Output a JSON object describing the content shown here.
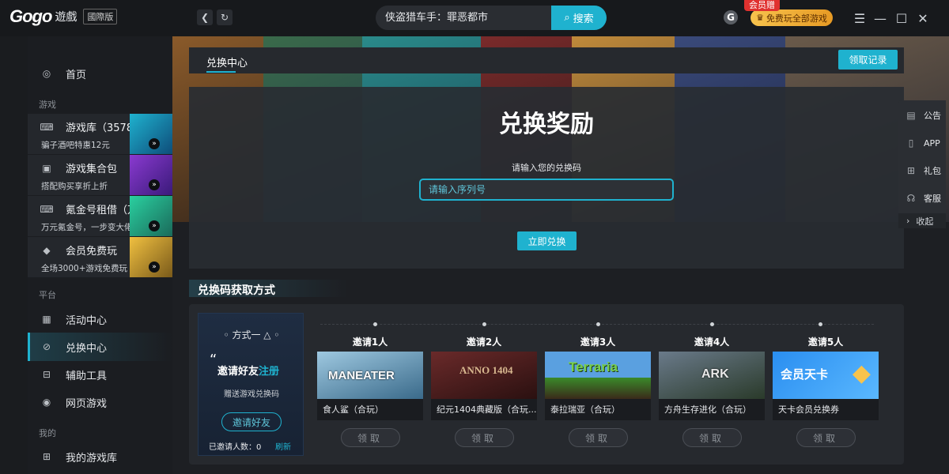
{
  "app": {
    "logo_text": "Gogo",
    "logo_sub": "遊戲",
    "region_badge": "國際版"
  },
  "topbar": {
    "search_value": "侠盗猎车手：罪恶都市",
    "search_label": "搜索",
    "account_letter": "G",
    "vip_tag": "会员赠",
    "vip_label": "免费玩全部游戏"
  },
  "sidebar": {
    "home": "首页",
    "group_games": "游戏",
    "game_items": [
      {
        "title": "游戏库（3578款）",
        "sub": "骗子酒吧特惠12元"
      },
      {
        "title": "游戏集合包",
        "sub": "搭配购买享折上折"
      },
      {
        "title": "氪金号租借（万元号）",
        "sub": "万元氪金号，一步变大佬"
      },
      {
        "title": "会员免费玩",
        "sub": "全场3000+游戏免费玩"
      }
    ],
    "group_platform": "平台",
    "platform_items": [
      {
        "label": "活动中心"
      },
      {
        "label": "兑换中心"
      },
      {
        "label": "辅助工具"
      },
      {
        "label": "网页游戏"
      }
    ],
    "group_mine": "我的",
    "mine_items": [
      {
        "label": "我的游戏库"
      }
    ]
  },
  "main": {
    "tab_label": "兑换中心",
    "record_button": "领取记录",
    "redeem_title": "兑换奖励",
    "redeem_label": "请输入您的兑换码",
    "redeem_placeholder": "请输入序列号",
    "redeem_button": "立即兑换"
  },
  "float_menu": {
    "items": [
      "公告",
      "APP",
      "礼包",
      "客服"
    ],
    "collapse": "收起"
  },
  "methods": {
    "section_title": "兑换码获取方式",
    "card_head": "方式一",
    "card_main_prefix": "邀请好友",
    "card_main_highlight": "注册",
    "card_sub": "赠送游戏兑换码",
    "card_invite_button": "邀请好友",
    "card_count_label": "已邀请人数：0",
    "card_refresh": "刷新",
    "rewards": [
      {
        "tier": "邀请1人",
        "name": "食人鲨（合玩）",
        "art": "MANEATER",
        "claim": "领取"
      },
      {
        "tier": "邀请2人",
        "name": "纪元1404典藏版（合玩...",
        "art": "ANNO 1404",
        "claim": "领取"
      },
      {
        "tier": "邀请3人",
        "name": "泰拉瑞亚（合玩）",
        "art": "Terraria",
        "claim": "领取"
      },
      {
        "tier": "邀请4人",
        "name": "方舟生存进化（合玩）",
        "art": "ARK",
        "claim": "领取"
      },
      {
        "tier": "邀请5人",
        "name": "天卡会员兑换券",
        "art": "会员天卡",
        "claim": "领取"
      }
    ]
  },
  "colors": {
    "accent": "#1fb2cf",
    "vip": "#f7c34d",
    "background": "#1d1f23"
  }
}
